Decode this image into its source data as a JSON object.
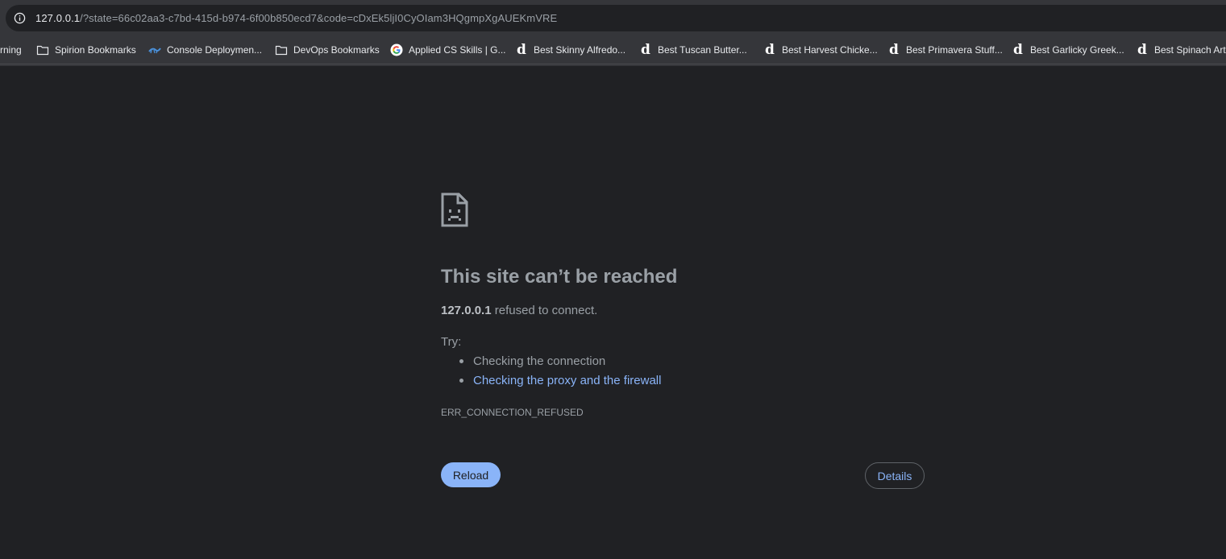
{
  "address_bar": {
    "host": "127.0.0.1",
    "path": "/?state=66c02aa3-c7bd-415d-b974-6f00b850ecd7&code=cDxEk5ljI0CyOIam3HQgmpXgAUEKmVRE",
    "icon": "info-icon"
  },
  "bookmarks": [
    {
      "label": "rning",
      "icon": "none"
    },
    {
      "label": "Spirion Bookmarks",
      "icon": "folder-icon"
    },
    {
      "label": "Console Deploymen...",
      "icon": "lizard-icon"
    },
    {
      "label": "DevOps Bookmarks",
      "icon": "folder-icon"
    },
    {
      "label": "Applied CS Skills | G...",
      "icon": "google-icon"
    },
    {
      "label": "Best Skinny Alfredo...",
      "icon": "d-icon"
    },
    {
      "label": "Best Tuscan Butter...",
      "icon": "d-icon"
    },
    {
      "label": "Best Harvest Chicke...",
      "icon": "d-icon"
    },
    {
      "label": "Best Primavera Stuff...",
      "icon": "d-icon"
    },
    {
      "label": "Best Garlicky Greek...",
      "icon": "d-icon"
    },
    {
      "label": "Best Spinach Arti",
      "icon": "d-icon"
    }
  ],
  "error_page": {
    "title": "This site can’t be reached",
    "host": "127.0.0.1",
    "summary_rest": "refused to connect.",
    "try_label": "Try:",
    "suggestions": [
      "Checking the connection",
      "Checking the proxy and the firewall"
    ],
    "error_code": "ERR_CONNECTION_REFUSED",
    "reload_label": "Reload",
    "details_label": "Details"
  },
  "colors": {
    "background": "#202124",
    "toolbar": "#35363a",
    "link": "#8ab4f8",
    "text": "#9aa0a6"
  }
}
